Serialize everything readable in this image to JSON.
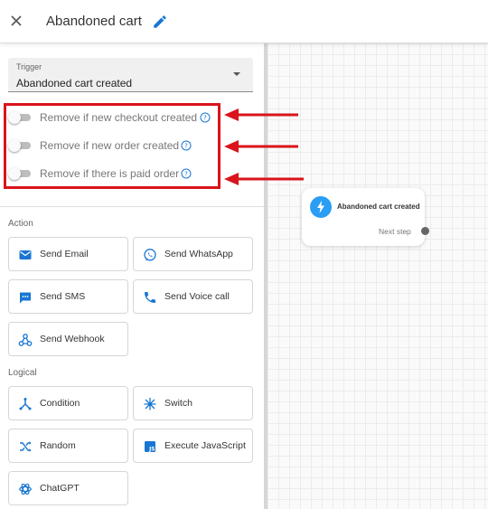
{
  "header": {
    "title": "Abandoned cart"
  },
  "trigger": {
    "label": "Trigger",
    "value": "Abandoned cart created"
  },
  "toggles": [
    {
      "label": "Remove if new checkout created",
      "on": false
    },
    {
      "label": "Remove if new order created",
      "on": false
    },
    {
      "label": "Remove if there is paid order",
      "on": false
    }
  ],
  "sections": {
    "action": "Action",
    "logical": "Logical"
  },
  "actions": {
    "send_email": "Send Email",
    "send_whatsapp": "Send WhatsApp",
    "send_sms": "Send SMS",
    "send_voice_call": "Send Voice call",
    "send_webhook": "Send Webhook"
  },
  "logical": {
    "condition": "Condition",
    "switch": "Switch",
    "random": "Random",
    "execute_javascript": "Execute JavaScript",
    "chatgpt": "ChatGPT"
  },
  "node": {
    "title": "Abandoned cart created",
    "next_step": "Next step"
  },
  "colors": {
    "accent": "#1976d2",
    "highlight": "#d9141b",
    "node_icon": "#2a9df4"
  },
  "icons": {
    "close": "close-icon",
    "edit": "pencil-icon",
    "help": "help-circle-icon",
    "email": "email-icon",
    "whatsapp": "whatsapp-icon",
    "sms": "sms-icon",
    "phone": "phone-icon",
    "webhook": "webhook-icon",
    "condition": "condition-icon",
    "switch": "switch-icon",
    "random": "shuffle-icon",
    "javascript": "javascript-icon",
    "chatgpt": "chatgpt-icon",
    "bolt": "bolt-icon"
  }
}
